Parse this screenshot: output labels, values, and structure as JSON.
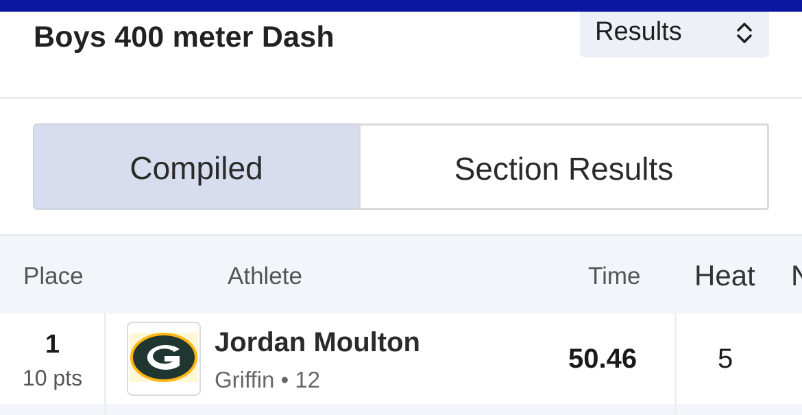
{
  "event": {
    "title": "Boys 400 meter Dash",
    "view_select": "Results"
  },
  "tabs": [
    {
      "label": "Compiled",
      "selected": true
    },
    {
      "label": "Section Results",
      "selected": false
    }
  ],
  "table": {
    "columns": {
      "place": "Place",
      "athlete": "Athlete",
      "time": "Time",
      "heat": "Heat",
      "next_cut": "N"
    },
    "rows": [
      {
        "place": "1",
        "points": "10 pts",
        "logo_icon": "green-bay-g-logo-icon",
        "athlete": "Jordan Moulton",
        "team_grade": "Griffin • 12",
        "time": "50.46",
        "heat": "5"
      }
    ]
  },
  "colors": {
    "topbar": "#0b17a0",
    "selected_tab": "#d7ddee",
    "logo_green": "#203731",
    "logo_gold": "#ffb612"
  }
}
